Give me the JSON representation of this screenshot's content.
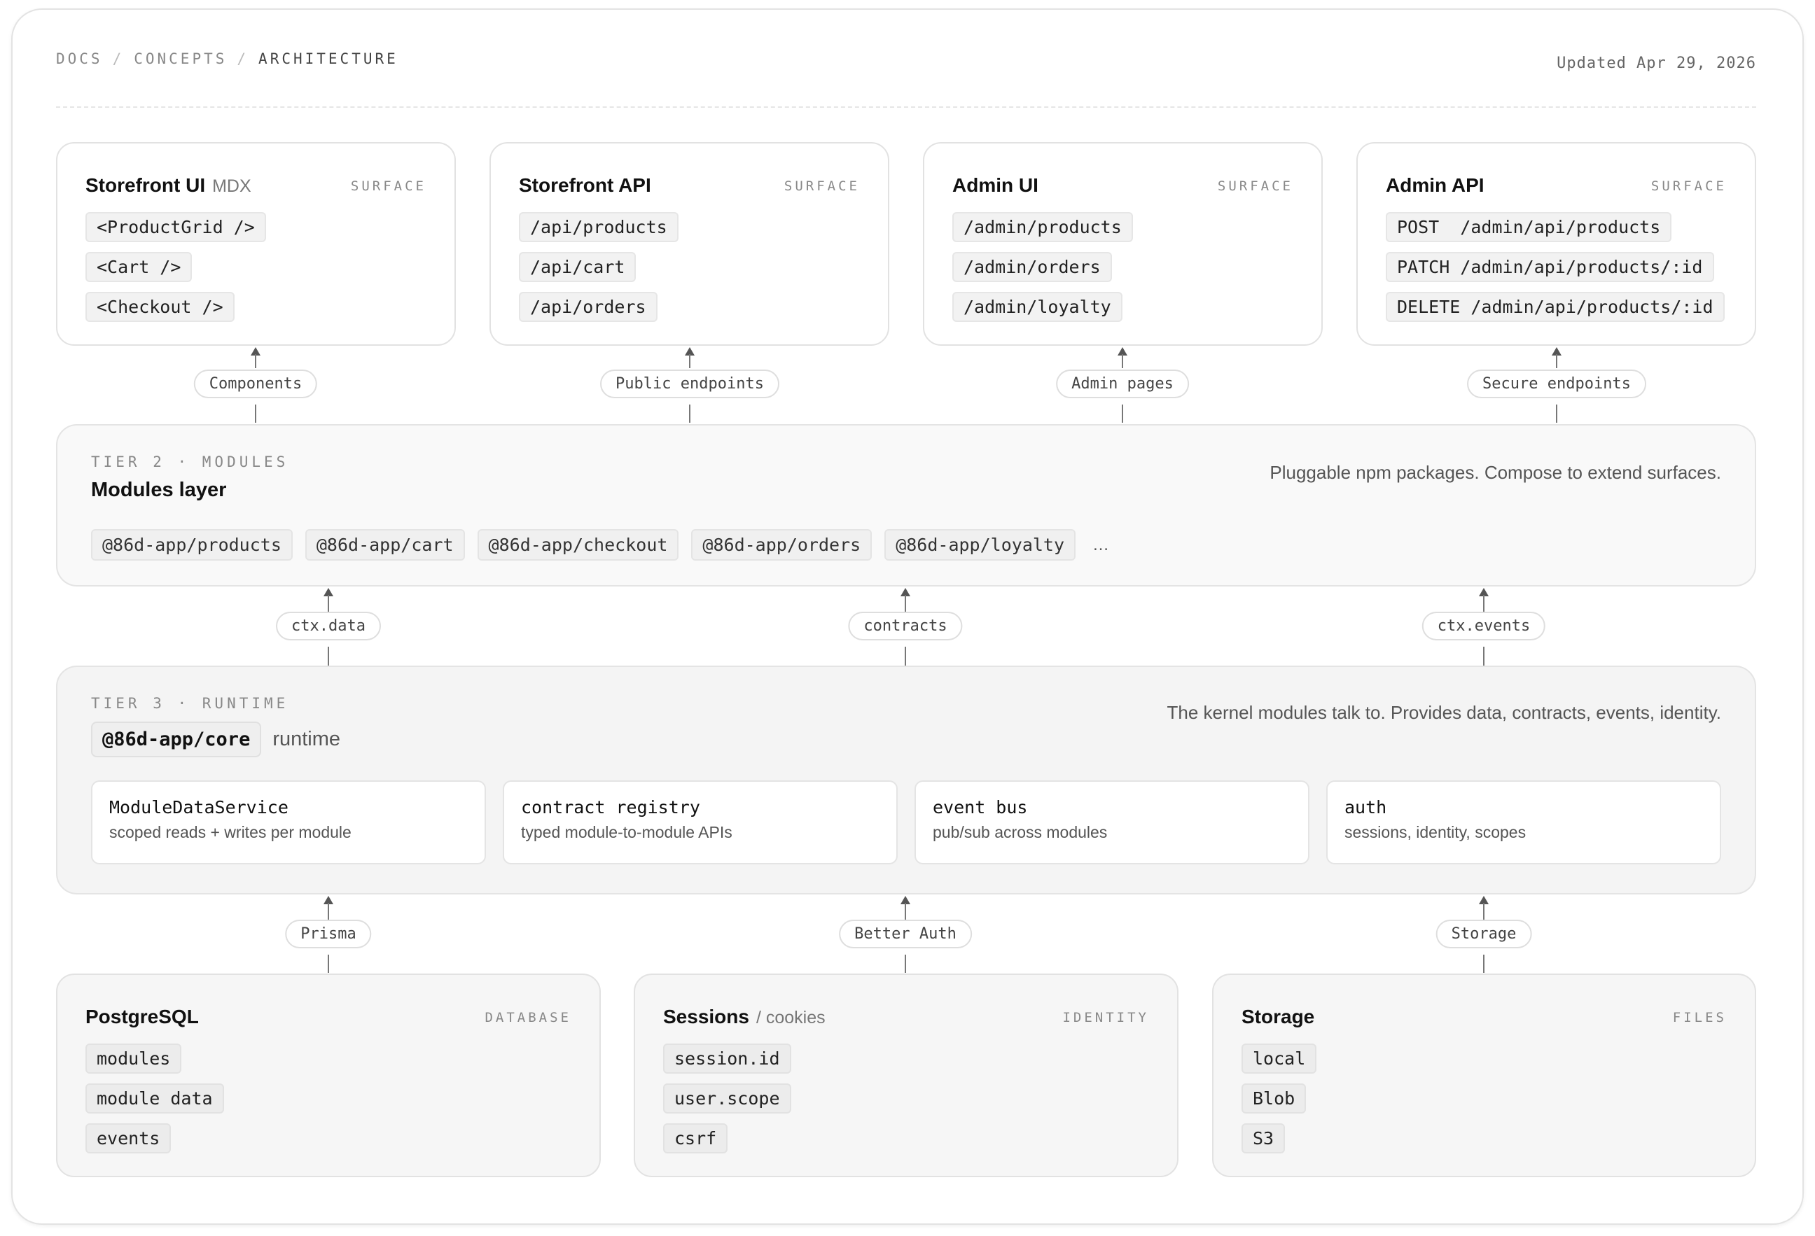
{
  "breadcrumb": {
    "items": [
      "DOCS",
      "CONCEPTS",
      "ARCHITECTURE"
    ]
  },
  "updated": "Updated Apr 29, 2026",
  "surfaces": [
    {
      "title": "Storefront UI",
      "subtitle": "MDX",
      "tag": "SURFACE",
      "chips": [
        "<ProductGrid />",
        "<Cart />",
        "<Checkout />"
      ],
      "connector": "Components"
    },
    {
      "title": "Storefront API",
      "subtitle": "",
      "tag": "SURFACE",
      "chips": [
        "/api/products",
        "/api/cart",
        "/api/orders"
      ],
      "connector": "Public endpoints"
    },
    {
      "title": "Admin UI",
      "subtitle": "",
      "tag": "SURFACE",
      "chips": [
        "/admin/products",
        "/admin/orders",
        "/admin/loyalty"
      ],
      "connector": "Admin pages"
    },
    {
      "title": "Admin API",
      "subtitle": "",
      "tag": "SURFACE",
      "chips": [
        "POST  /admin/api/products",
        "PATCH /admin/api/products/:id",
        "DELETE /admin/api/products/:id"
      ],
      "connector": "Secure endpoints"
    }
  ],
  "tier2": {
    "label": "TIER 2 · MODULES",
    "title": "Modules layer",
    "description": "Pluggable npm packages. Compose to extend surfaces.",
    "packages": [
      "@86d-app/products",
      "@86d-app/cart",
      "@86d-app/checkout",
      "@86d-app/orders",
      "@86d-app/loyalty"
    ],
    "more": "…"
  },
  "tier2_connectors": [
    "ctx.data",
    "contracts",
    "ctx.events"
  ],
  "tier3": {
    "label": "TIER 3 · RUNTIME",
    "core_package": "@86d-app/core",
    "core_suffix": "runtime",
    "description": "The kernel modules talk to. Provides data, contracts, events, identity.",
    "services": [
      {
        "name": "ModuleDataService",
        "desc": "scoped reads + writes per module"
      },
      {
        "name": "contract registry",
        "desc": "typed module-to-module APIs"
      },
      {
        "name": "event bus",
        "desc": "pub/sub across modules"
      },
      {
        "name": "auth",
        "desc": "sessions, identity, scopes"
      }
    ]
  },
  "tier3_connectors": [
    "Prisma",
    "Better Auth",
    "Storage"
  ],
  "backends": [
    {
      "title": "PostgreSQL",
      "subtitle": "",
      "tag": "DATABASE",
      "chips": [
        "modules",
        "module data",
        "events"
      ]
    },
    {
      "title": "Sessions",
      "subtitle": "/ cookies",
      "tag": "IDENTITY",
      "chips": [
        "session.id",
        "user.scope",
        "csrf"
      ]
    },
    {
      "title": "Storage",
      "subtitle": "",
      "tag": "FILES",
      "chips": [
        "local",
        "Blob",
        "S3"
      ]
    }
  ],
  "colors": {
    "border": "#e2e2e2",
    "chip_bg": "#f2f2f2",
    "tier_bg": "#f6f6f6",
    "text_muted": "#888888"
  }
}
